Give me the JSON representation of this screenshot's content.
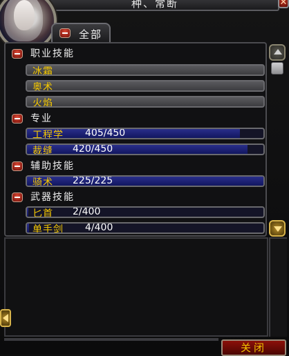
{
  "window": {
    "title": "种、常断",
    "close_button_label": "关闭"
  },
  "tab": {
    "label": "全部"
  },
  "sections": [
    {
      "name": "职业技能",
      "skills": [
        {
          "name": "冰霜",
          "rank": "",
          "fill": 0,
          "style": "gray"
        },
        {
          "name": "奥术",
          "rank": "",
          "fill": 0,
          "style": "gray"
        },
        {
          "name": "火焰",
          "rank": "",
          "fill": 0,
          "style": "gray"
        }
      ]
    },
    {
      "name": "专业",
      "skills": [
        {
          "name": "工程学",
          "rank": "405/450",
          "fill": 0.9,
          "style": "blue"
        },
        {
          "name": "裁缝",
          "rank": "420/450",
          "fill": 0.933,
          "style": "blue"
        }
      ]
    },
    {
      "name": "辅助技能",
      "skills": [
        {
          "name": "骑术",
          "rank": "225/225",
          "fill": 1.0,
          "style": "blue"
        }
      ]
    },
    {
      "name": "武器技能",
      "skills": [
        {
          "name": "匕首",
          "rank": "2/400",
          "fill": 0.005,
          "style": "blue"
        },
        {
          "name": "单手剑",
          "rank": "4/400",
          "fill": 0.01,
          "style": "blue"
        }
      ]
    }
  ],
  "icons": {
    "collapse": "minus-icon",
    "scroll_up": "up-arrow-icon",
    "scroll_down": "down-arrow-icon",
    "page_left": "left-arrow-icon",
    "close_x": "close-icon"
  },
  "colors": {
    "skill_name": "#f6c900",
    "skill_rank": "#ffffff",
    "bar_fill": "#1c2078",
    "toggle": "#c8321f"
  }
}
